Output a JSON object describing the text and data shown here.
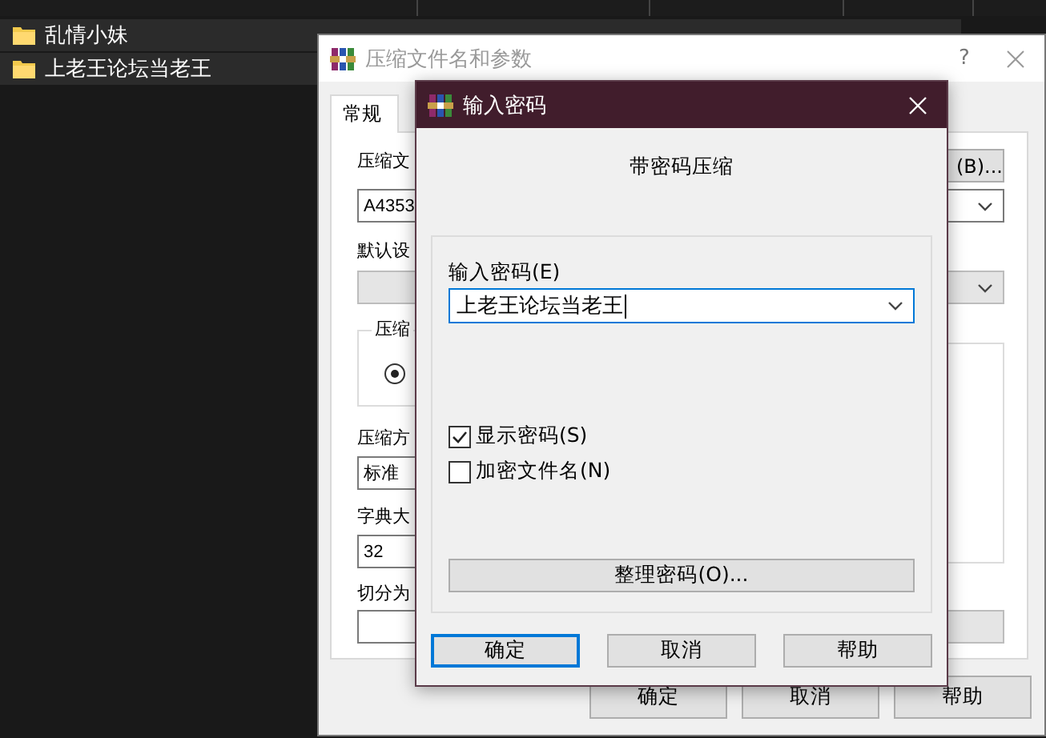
{
  "explorer": {
    "rows": [
      {
        "name": "乱情小妹"
      },
      {
        "name": "上老王论坛当老王"
      }
    ]
  },
  "archive_dialog": {
    "title": "压缩文件名和参数",
    "help": "?",
    "tabs": [
      {
        "label": "常规",
        "selected": true
      }
    ],
    "archive_name": {
      "label": "压缩文",
      "value": "A4353",
      "browse": "(B)..."
    },
    "profile": {
      "label": "默认设"
    },
    "format_group": {
      "label": "压缩",
      "radio_selected": true
    },
    "method": {
      "label": "压缩方",
      "value": "标准"
    },
    "dictionary": {
      "label": "字典大",
      "value": "32"
    },
    "split": {
      "label": "切分为"
    },
    "buttons": [
      "确定",
      "取消",
      "帮助"
    ]
  },
  "password_dialog": {
    "title": "输入密码",
    "heading": "带密码压缩",
    "password_label": "输入密码(E)",
    "password": "上老王论坛当老王",
    "options": [
      {
        "label": "显示密码(S)",
        "checked": true
      },
      {
        "label": "加密文件名(N)",
        "checked": false
      }
    ],
    "organize_button": "整理密码(O)...",
    "buttons": [
      {
        "label": "确定",
        "default": true
      },
      {
        "label": "取消",
        "default": false
      },
      {
        "label": "帮助",
        "default": false
      }
    ]
  }
}
